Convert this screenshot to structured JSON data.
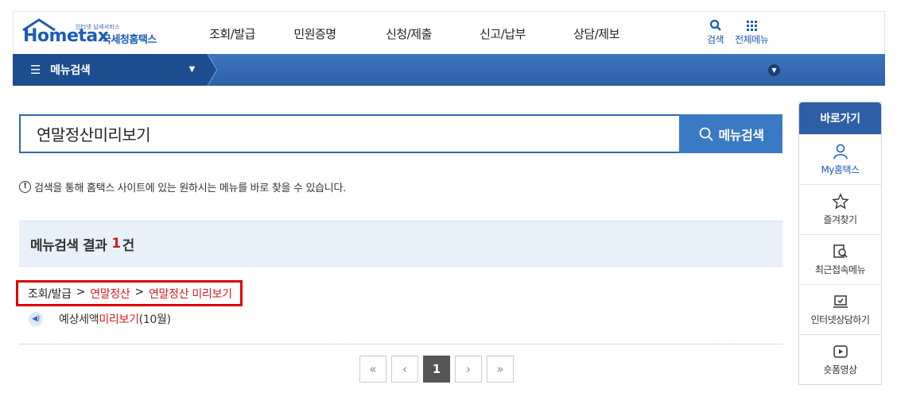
{
  "logo": {
    "text": "Hometax",
    "subtitle": "인터넷 납세서비스",
    "korean": "국세청홈택스"
  },
  "gnb": [
    "조회/발급",
    "민원증명",
    "신청/제출",
    "신고/납부",
    "상담/제보"
  ],
  "util": {
    "search": "검색",
    "all_menu": "전체메뉴"
  },
  "bar": {
    "menu_search": "메뉴검색"
  },
  "search": {
    "value": "연말정산미리보기",
    "button": "메뉴검색"
  },
  "notice": "검색을 통해 홈택스 사이트에 있는 원하시는 메뉴를 바로 찾을 수 있습니다.",
  "result": {
    "prefix": "메뉴검색 결과",
    "count": "1",
    "suffix": "건"
  },
  "breadcrumb": {
    "level1": "조회/발급",
    "sep": ">",
    "level2": "연말정산",
    "level3": "연말정산 미리보기"
  },
  "sub_item": {
    "prefix": "예상세액 ",
    "link": "미리보기",
    "suffix": "(10월)"
  },
  "pager": {
    "first": "«",
    "prev": "‹",
    "current": "1",
    "next": "›",
    "last": "»"
  },
  "quick": {
    "title": "바로가기",
    "items": [
      "My홈택스",
      "즐겨찾기",
      "최근접속메뉴",
      "인터넷상담하기",
      "숏폼영상"
    ]
  },
  "colors": {
    "brand": "#1d5cb6",
    "bar": "#2e62a9",
    "highlight": "#e00000",
    "result_bg": "#e8f1fa"
  }
}
